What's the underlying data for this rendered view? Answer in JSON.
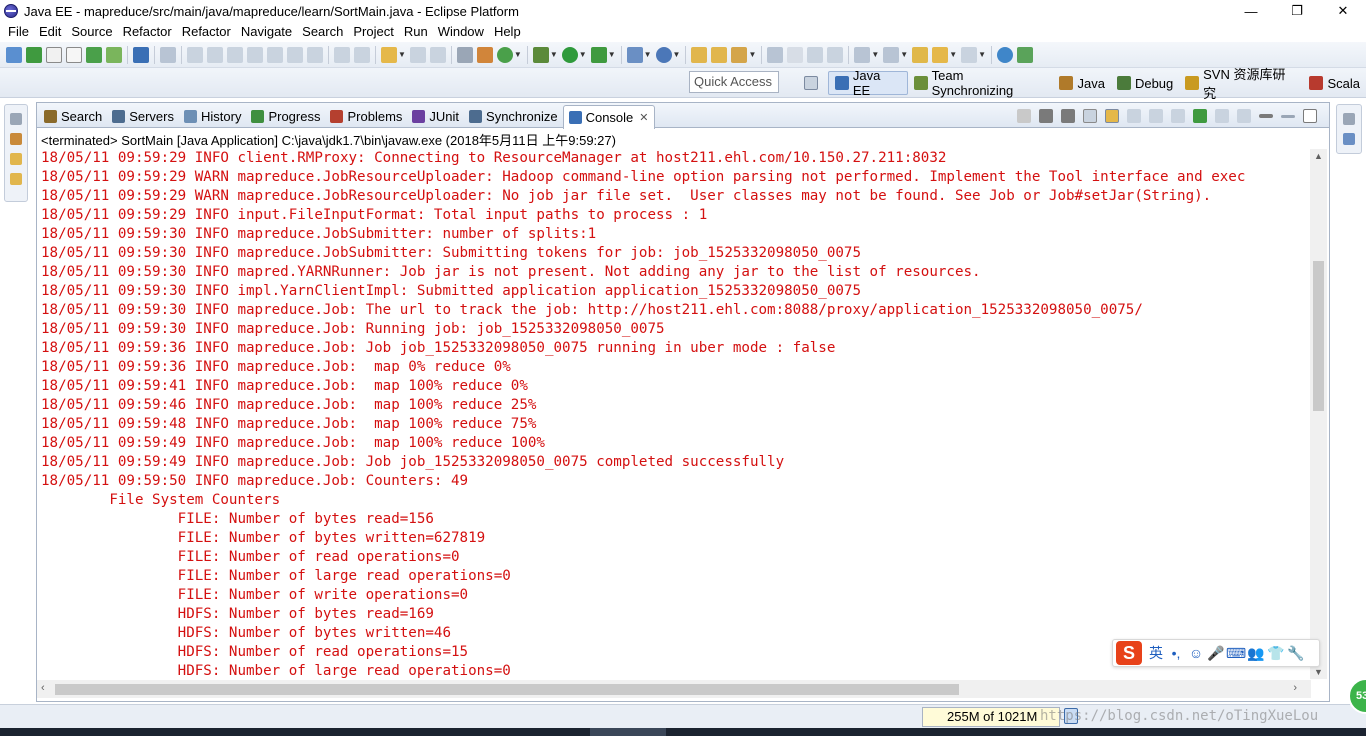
{
  "window": {
    "title": "Java EE - mapreduce/src/main/java/mapreduce/learn/SortMain.java - Eclipse Platform",
    "minimize": "—",
    "maximize": "❐",
    "close": "✕"
  },
  "menu": [
    "File",
    "Edit",
    "Source",
    "Refactor",
    "Refactor",
    "Navigate",
    "Search",
    "Project",
    "Run",
    "Window",
    "Help"
  ],
  "quick_access": {
    "placeholder": "Quick Access"
  },
  "perspectives": [
    {
      "label": "Java EE",
      "active": true,
      "color": "#3a6fb5"
    },
    {
      "label": "Team Synchronizing",
      "active": false,
      "color": "#6b8f3a"
    },
    {
      "label": "Java",
      "active": false,
      "color": "#b07a2a"
    },
    {
      "label": "Debug",
      "active": false,
      "color": "#4b7b3b"
    },
    {
      "label": "SVN 资源库研究",
      "active": false,
      "color": "#c99a20"
    },
    {
      "label": "Scala",
      "active": false,
      "color": "#b83a2e"
    }
  ],
  "view_tabs": [
    {
      "label": "Search",
      "active": false,
      "color": "#8a6a2a"
    },
    {
      "label": "Servers",
      "active": false,
      "color": "#4d6c8f"
    },
    {
      "label": "History",
      "active": false,
      "color": "#6d8fb5"
    },
    {
      "label": "Progress",
      "active": false,
      "color": "#3f8f3f"
    },
    {
      "label": "Problems",
      "active": false,
      "color": "#b5402f"
    },
    {
      "label": "JUnit",
      "active": false,
      "color": "#6b3fa0"
    },
    {
      "label": "Synchronize",
      "active": false,
      "color": "#4d6c8f"
    },
    {
      "label": "Console",
      "active": true,
      "color": "#3a6fb5"
    }
  ],
  "console": {
    "header": "<terminated> SortMain [Java Application] C:\\java\\jdk1.7\\bin\\javaw.exe (2018年5月11日 上午9:59:27)",
    "lines": [
      "18/05/11 09:59:29 INFO client.RMProxy: Connecting to ResourceManager at host211.ehl.com/10.150.27.211:8032",
      "18/05/11 09:59:29 WARN mapreduce.JobResourceUploader: Hadoop command-line option parsing not performed. Implement the Tool interface and exec",
      "18/05/11 09:59:29 WARN mapreduce.JobResourceUploader: No job jar file set.  User classes may not be found. See Job or Job#setJar(String).",
      "18/05/11 09:59:29 INFO input.FileInputFormat: Total input paths to process : 1",
      "18/05/11 09:59:30 INFO mapreduce.JobSubmitter: number of splits:1",
      "18/05/11 09:59:30 INFO mapreduce.JobSubmitter: Submitting tokens for job: job_1525332098050_0075",
      "18/05/11 09:59:30 INFO mapred.YARNRunner: Job jar is not present. Not adding any jar to the list of resources.",
      "18/05/11 09:59:30 INFO impl.YarnClientImpl: Submitted application application_1525332098050_0075",
      "18/05/11 09:59:30 INFO mapreduce.Job: The url to track the job: http://host211.ehl.com:8088/proxy/application_1525332098050_0075/",
      "18/05/11 09:59:30 INFO mapreduce.Job: Running job: job_1525332098050_0075",
      "18/05/11 09:59:36 INFO mapreduce.Job: Job job_1525332098050_0075 running in uber mode : false",
      "18/05/11 09:59:36 INFO mapreduce.Job:  map 0% reduce 0%",
      "18/05/11 09:59:41 INFO mapreduce.Job:  map 100% reduce 0%",
      "18/05/11 09:59:46 INFO mapreduce.Job:  map 100% reduce 25%",
      "18/05/11 09:59:48 INFO mapreduce.Job:  map 100% reduce 75%",
      "18/05/11 09:59:49 INFO mapreduce.Job:  map 100% reduce 100%",
      "18/05/11 09:59:49 INFO mapreduce.Job: Job job_1525332098050_0075 completed successfully",
      "18/05/11 09:59:50 INFO mapreduce.Job: Counters: 49",
      "        File System Counters",
      "                FILE: Number of bytes read=156",
      "                FILE: Number of bytes written=627819",
      "                FILE: Number of read operations=0",
      "                FILE: Number of large read operations=0",
      "                FILE: Number of write operations=0",
      "                HDFS: Number of bytes read=169",
      "                HDFS: Number of bytes written=46",
      "                HDFS: Number of read operations=15",
      "                HDFS: Number of large read operations=0"
    ],
    "text_color": "#d41010"
  },
  "ime": {
    "logo": "S",
    "items": [
      "英",
      "•,",
      "☺",
      "🎤",
      "⌨",
      "👥",
      "👕",
      "🔧"
    ]
  },
  "status": {
    "heap": "255M of 1021M",
    "watermark": "https://blog.csdn.net/oTingXueLou",
    "badge": "53"
  }
}
